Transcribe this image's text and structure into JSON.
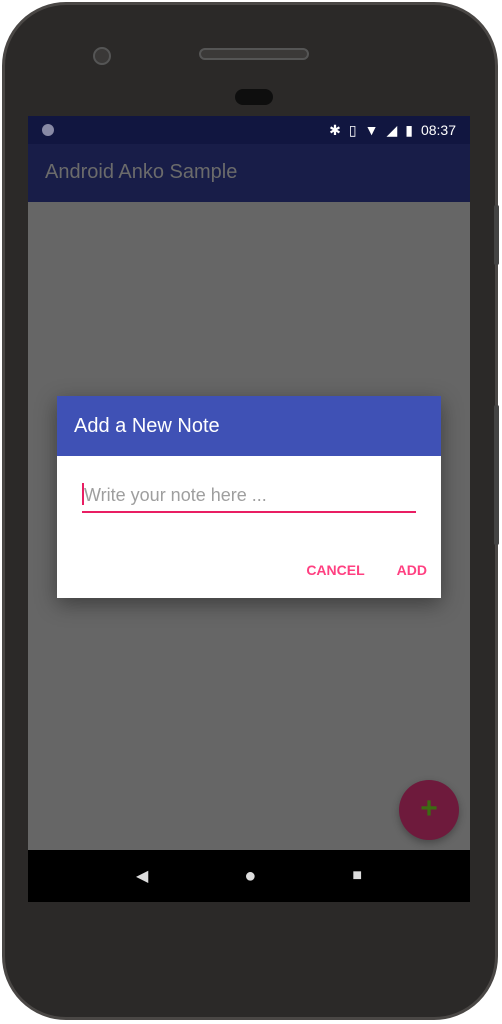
{
  "status": {
    "time": "08:37",
    "icons": [
      "notification-dot-icon",
      "bluetooth-icon",
      "vibrate-icon",
      "wifi-icon",
      "signal-icon",
      "battery-charging-icon"
    ]
  },
  "appbar": {
    "title": "Android Anko Sample"
  },
  "dialog": {
    "title": "Add a New Note",
    "input_value": "",
    "input_placeholder": "Write your note here ...",
    "cancel_label": "CANCEL",
    "add_label": "ADD"
  },
  "fab": {
    "icon": "plus-icon",
    "glyph": "+"
  },
  "nav": {
    "back": "◀",
    "home": "●",
    "recents": "■"
  },
  "colors": {
    "primary": "#3f51b5",
    "accent": "#ff4081",
    "status_bar": "#111640"
  }
}
